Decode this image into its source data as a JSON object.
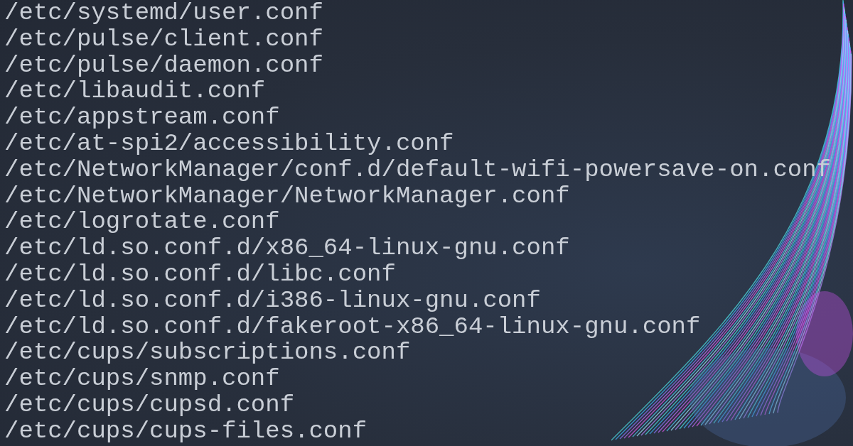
{
  "terminal": {
    "lines": [
      "/etc/systemd/user.conf",
      "/etc/pulse/client.conf",
      "/etc/pulse/daemon.conf",
      "/etc/libaudit.conf",
      "/etc/appstream.conf",
      "/etc/at-spi2/accessibility.conf",
      "/etc/NetworkManager/conf.d/default-wifi-powersave-on.conf",
      "/etc/NetworkManager/NetworkManager.conf",
      "/etc/logrotate.conf",
      "/etc/ld.so.conf.d/x86_64-linux-gnu.conf",
      "/etc/ld.so.conf.d/libc.conf",
      "/etc/ld.so.conf.d/i386-linux-gnu.conf",
      "/etc/ld.so.conf.d/fakeroot-x86_64-linux-gnu.conf",
      "/etc/cups/subscriptions.conf",
      "/etc/cups/snmp.conf",
      "/etc/cups/cupsd.conf",
      "/etc/cups/cups-files.conf"
    ]
  }
}
